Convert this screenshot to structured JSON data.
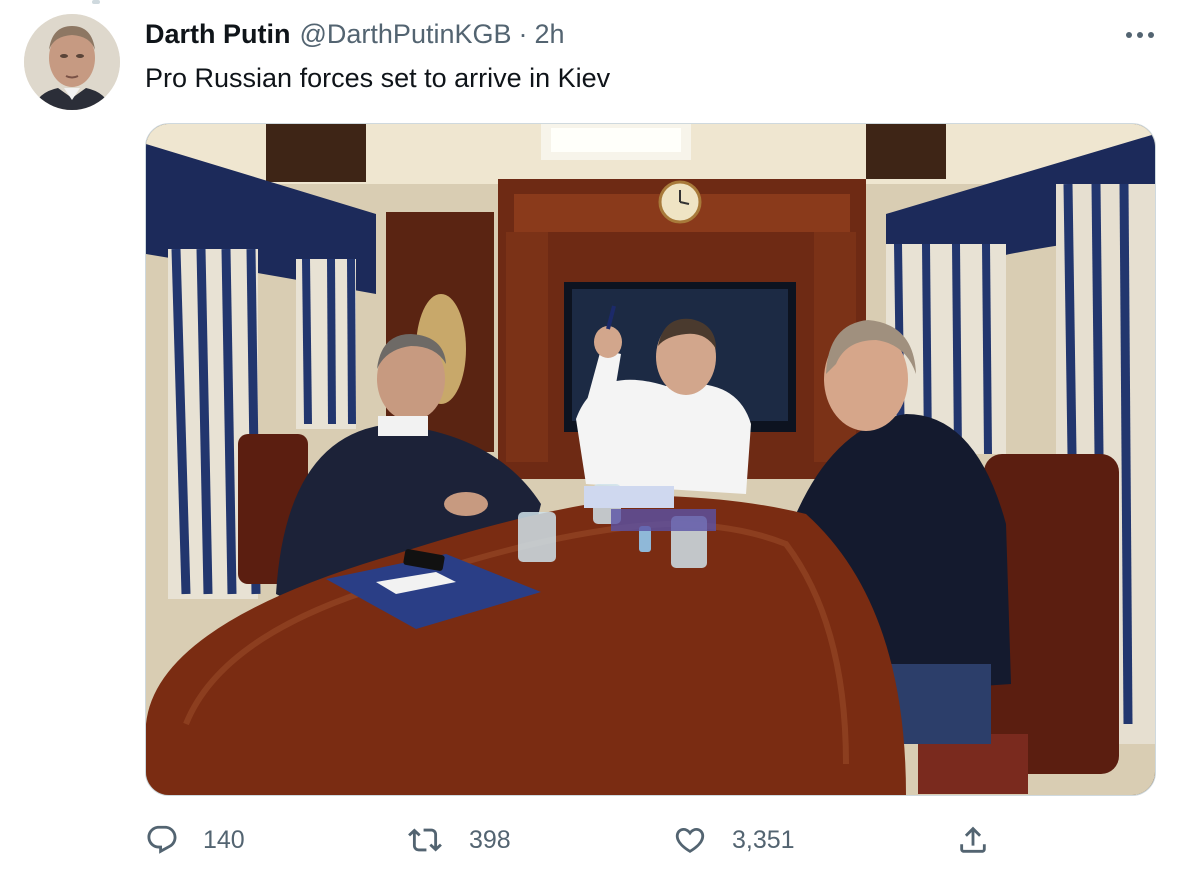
{
  "tweet": {
    "author": {
      "display_name": "Darth Putin",
      "handle": "@DarthPutinKGB",
      "separator": "·",
      "timestamp": "2h",
      "avatar_icon": "user-avatar-photo"
    },
    "text": "Pro Russian forces set to arrive in Kiev",
    "more_icon": "more-horizontal-icon",
    "media": {
      "type": "photo",
      "icon": "photo"
    },
    "actions": {
      "reply": {
        "icon": "reply-icon",
        "count": "140"
      },
      "retweet": {
        "icon": "retweet-icon",
        "count": "398"
      },
      "like": {
        "icon": "heart-icon",
        "count": "3,351"
      },
      "share": {
        "icon": "share-icon"
      }
    }
  },
  "colors": {
    "text_primary": "#0f1419",
    "text_secondary": "#536471",
    "border": "#cfd9de"
  }
}
